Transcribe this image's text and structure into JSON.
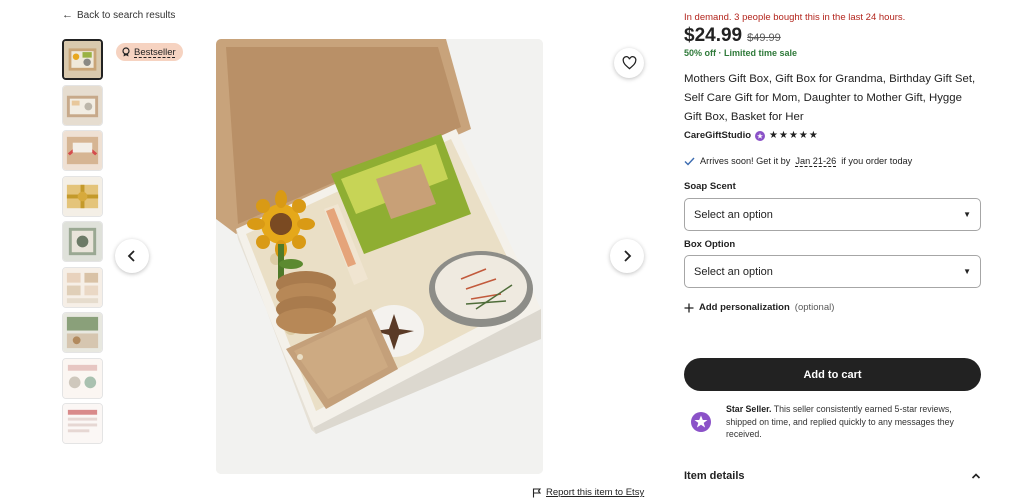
{
  "nav": {
    "back_label": "Back to search results"
  },
  "badge": {
    "label": "Bestseller"
  },
  "product": {
    "demand_text": "In demand. 3 people bought this in the last 24 hours.",
    "price": "$24.99",
    "original_price": "$49.99",
    "sale_text": "50% off · Limited time sale",
    "title": "Mothers Gift Box, Gift Box for Grandma, Birthday Gift Set, Self Care Gift for Mom, Daughter to Mother Gift, Hygge Gift Box, Basket for Her",
    "shop_name": "CareGiftStudio",
    "rating_stars": "★★★★★",
    "rating": 5
  },
  "shipping": {
    "prefix": "Arrives soon! Get it by",
    "dates": "Jan 21-26",
    "suffix": "if you order today"
  },
  "options": {
    "soap_scent": {
      "label": "Soap Scent",
      "value": "Select an option"
    },
    "box_option": {
      "label": "Box Option",
      "value": "Select an option"
    }
  },
  "personalization": {
    "label": "Add personalization",
    "optional": "(optional)"
  },
  "cart": {
    "button_label": "Add to cart"
  },
  "star_seller": {
    "title": "Star Seller.",
    "text": "This seller consistently earned 5-star reviews, shipped on time, and replied quickly to any messages they received."
  },
  "item_details": {
    "label": "Item details"
  },
  "report": {
    "label": "Report this item to Etsy"
  },
  "colors": {
    "demand": "#b3261e",
    "sale": "#2f7a3a",
    "badge_bg": "#f6d3c1",
    "cart_bg": "#222222",
    "star_seller": "#8b52c8"
  },
  "thumbnails": [
    "thumb-1",
    "thumb-2",
    "thumb-3",
    "thumb-4",
    "thumb-5",
    "thumb-6",
    "thumb-7",
    "thumb-8",
    "thumb-9"
  ],
  "icons": {
    "back": "arrow-left-icon",
    "favorite": "heart-icon",
    "prev": "chevron-left-icon",
    "next": "chevron-right-icon",
    "check": "check-icon",
    "plus": "plus-icon",
    "flag": "flag-icon",
    "star_seller": "star-seller-icon",
    "collapse": "chevron-up-icon"
  }
}
